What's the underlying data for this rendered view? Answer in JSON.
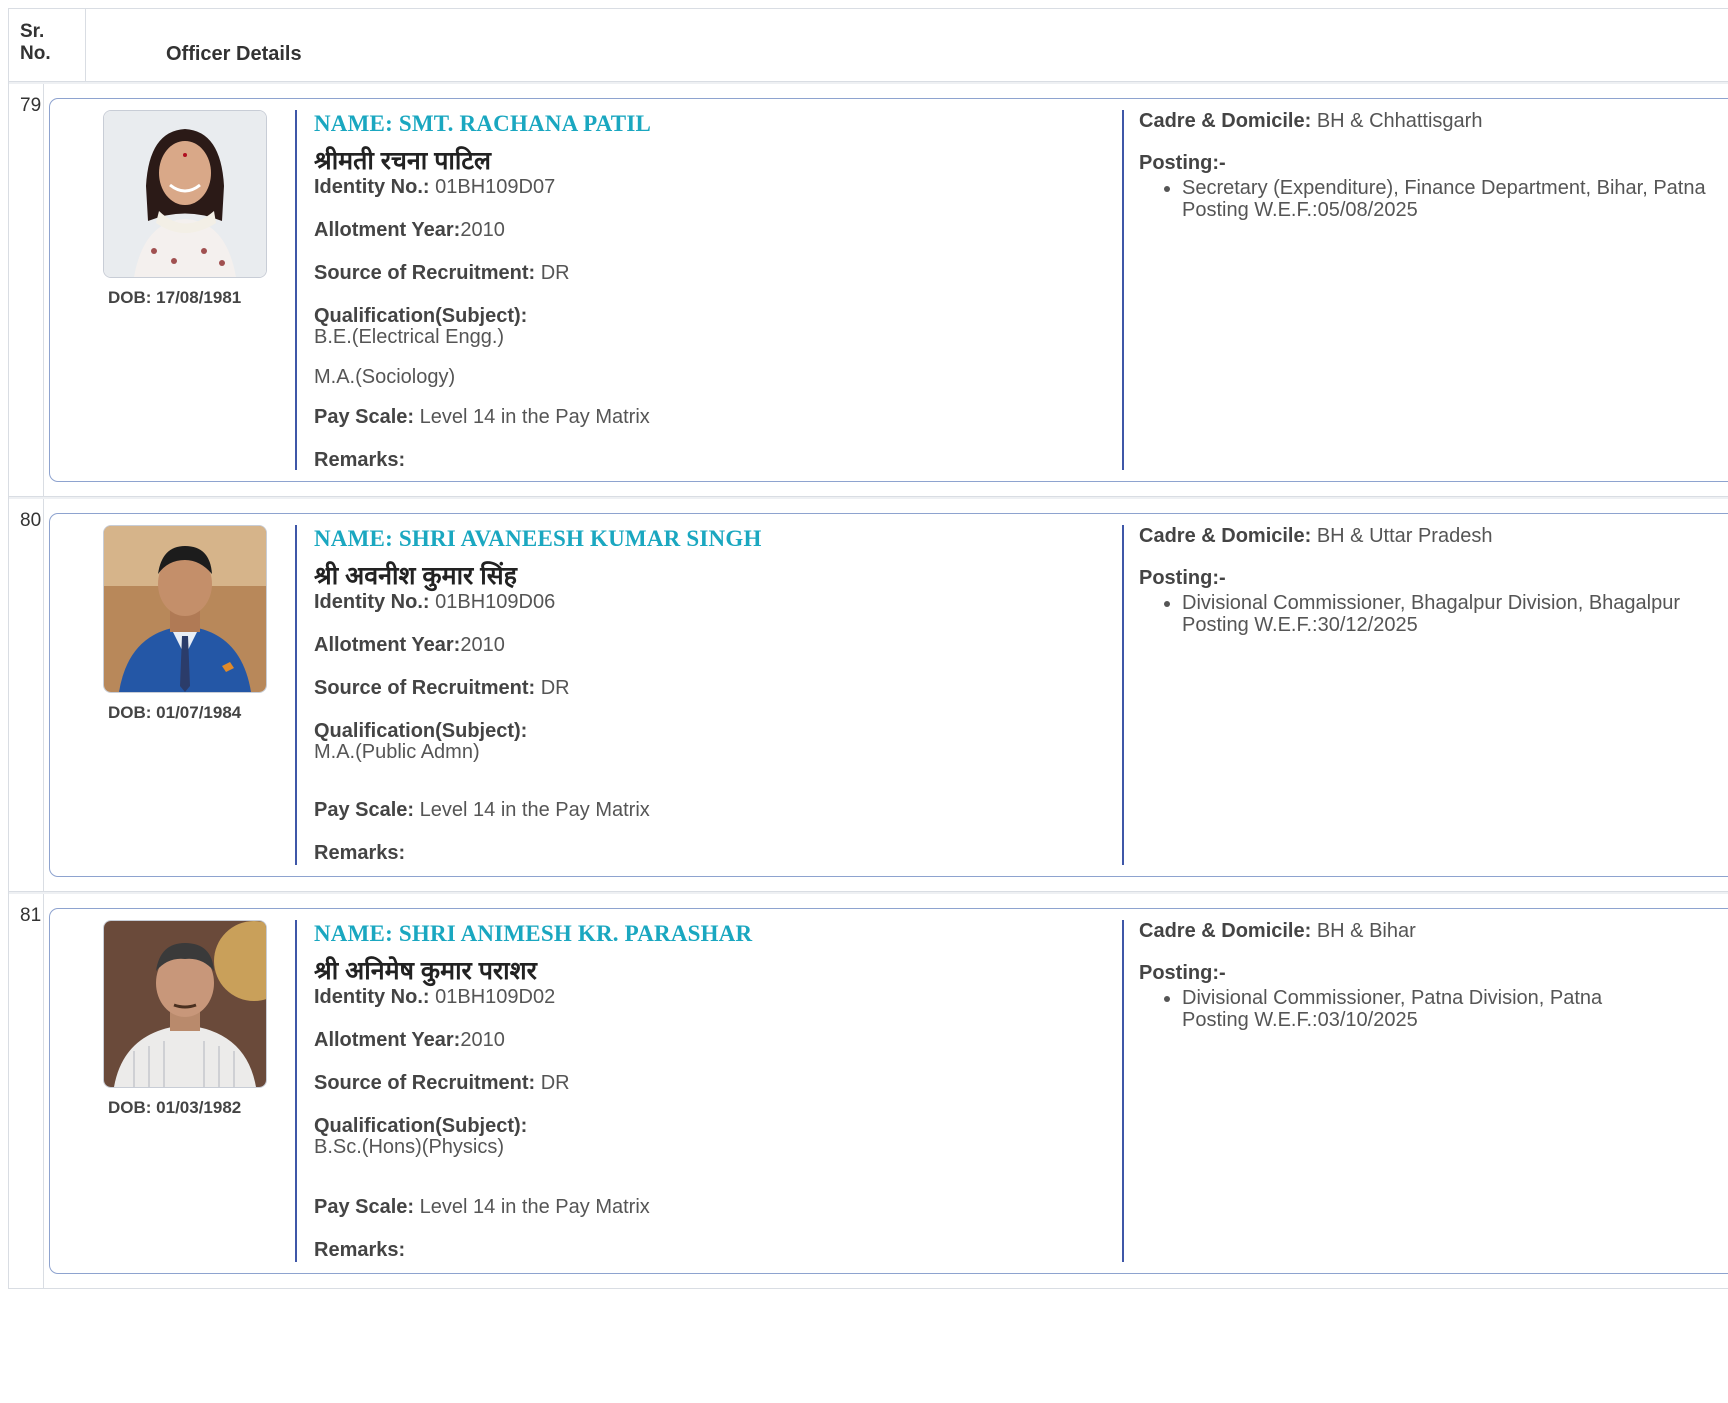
{
  "table": {
    "header_sr": "Sr.\nNo.",
    "header_sr_line1": "Sr.",
    "header_sr_line2": "No.",
    "header_details": "Officer Details"
  },
  "labels": {
    "identity": "Identity No.:",
    "allotment": "Allotment Year:",
    "source": "Source of Recruitment:",
    "qualification": "Qualification(Subject):",
    "pay_scale": "Pay Scale:",
    "remarks": "Remarks:",
    "cadre": "Cadre & Domicile:",
    "posting": "Posting:-",
    "wef": "Posting W.E.F.:"
  },
  "officers": [
    {
      "sr": "79",
      "name_en": "NAME: SMT. RACHANA PATIL",
      "name_hi": "श्रीमती रचना पाटिल",
      "dob": "DOB: 17/08/1981",
      "identity": "01BH109D07",
      "allotment": "2010",
      "source": "DR",
      "qualification_1": "B.E.(Electrical Engg.)",
      "qualification_2": "M.A.(Sociology)",
      "pay_scale": "Level 14 in the Pay Matrix",
      "remarks": "",
      "cadre": "BH & Chhattisgarh",
      "posting": "Secretary (Expenditure), Finance Department, Bihar, Patna",
      "wef": "05/08/2025"
    },
    {
      "sr": "80",
      "name_en": "NAME: SHRI AVANEESH KUMAR SINGH",
      "name_hi": "श्री अवनीश कुमार सिंह",
      "dob": "DOB: 01/07/1984",
      "identity": "01BH109D06",
      "allotment": "2010",
      "source": "DR",
      "qualification_1": "M.A.(Public Admn)",
      "qualification_2": "",
      "pay_scale": "Level 14 in the Pay Matrix",
      "remarks": "",
      "cadre": "BH & Uttar Pradesh",
      "posting": "Divisional Commissioner, Bhagalpur Division, Bhagalpur",
      "wef": "30/12/2025"
    },
    {
      "sr": "81",
      "name_en": "NAME: SHRI ANIMESH KR. PARASHAR",
      "name_hi": "श्री अनिमेष कुमार पराशर",
      "dob": "DOB: 01/03/1982",
      "identity": "01BH109D02",
      "allotment": "2010",
      "source": "DR",
      "qualification_1": "B.Sc.(Hons)(Physics)",
      "qualification_2": "",
      "pay_scale": "Level 14 in the Pay Matrix",
      "remarks": "",
      "cadre": "BH & Bihar",
      "posting": "Divisional Commissioner, Patna Division, Patna",
      "wef": "03/10/2025"
    }
  ]
}
